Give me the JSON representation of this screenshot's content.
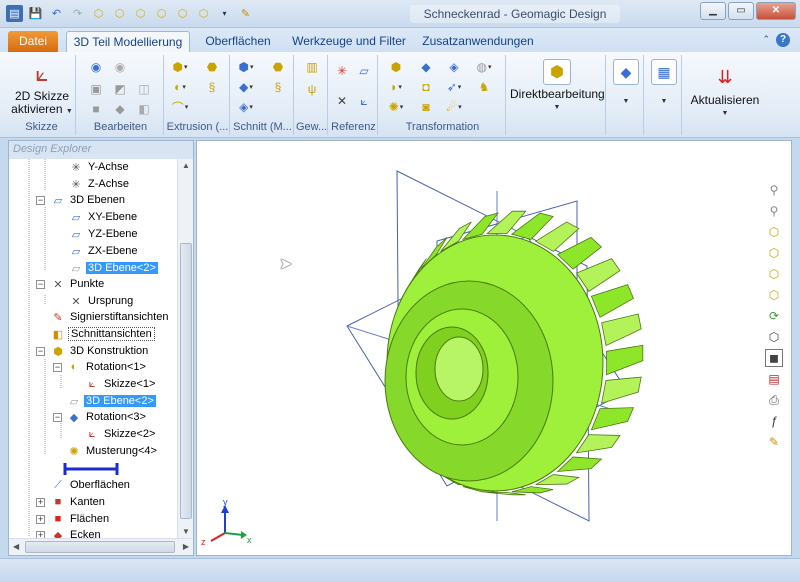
{
  "app": {
    "title": "Schneckenrad - Geomagic Design"
  },
  "tabs": {
    "file": "Datei",
    "items": [
      "3D Teil Modellierung",
      "Oberflächen",
      "Werkzeuge und Filter",
      "Zusatzanwendungen"
    ],
    "active": "3D Teil Modellierung"
  },
  "ribbon": {
    "groups": {
      "skizze": "Skizze",
      "bearbeiten": "Bearbeiten",
      "extrusion": "Extrusion (...",
      "schnitt": "Schnitt (M...",
      "gew": "Gew...",
      "referenz": "Referenz",
      "transformation": "Transformation"
    },
    "skizze_button_line1": "2D Skizze",
    "skizze_button_line2": "aktivieren",
    "direkt_button": "Direktbearbeitung",
    "aktualisieren_button": "Aktualisieren"
  },
  "explorer": {
    "header": "Design Explorer",
    "nodes": {
      "y_achse": "Y-Achse",
      "z_achse": "Z-Achse",
      "ebenen": "3D Ebenen",
      "xy": "XY-Ebene",
      "yz": "YZ-Ebene",
      "zx": "ZX-Ebene",
      "ebene2": "3D Ebene<2>",
      "punkte": "Punkte",
      "ursprung": "Ursprung",
      "signier": "Signierstiftansichten",
      "schnitt": "Schnittansichten",
      "konstruktion": "3D Konstruktion",
      "rotation1": "Rotation<1>",
      "skizze1": "Skizze<1>",
      "ebene2b": "3D Ebene<2>",
      "rotation3": "Rotation<3>",
      "skizze2": "Skizze<2>",
      "musterung": "Musterung<4>",
      "oberflaechen": "Oberflächen",
      "kanten": "Kanten",
      "flaechen": "Flächen",
      "ecken": "Ecken"
    }
  },
  "viewport": {
    "model_color": "#8ee62a",
    "axes": {
      "x": "x",
      "y": "y",
      "z": "z"
    }
  },
  "colors": {
    "accent": "#3399ff",
    "file_tab": "#e8821f"
  }
}
